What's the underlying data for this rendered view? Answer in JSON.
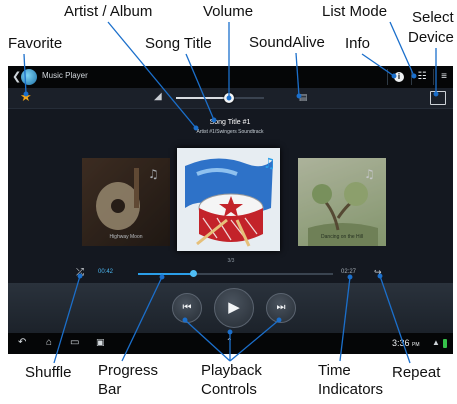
{
  "annotations": {
    "artist_album": "Artist / Album",
    "volume": "Volume",
    "list_mode": "List Mode",
    "select": "Select",
    "device": "Device",
    "favorite": "Favorite",
    "song_title": "Song Title",
    "soundalive": "SoundAlive",
    "info": "Info",
    "shuffle": "Shuffle",
    "progress": "Progress",
    "bar": "Bar",
    "playback": "Playback",
    "controls": "Controls",
    "time": "Time",
    "indicators": "Indicators",
    "repeat": "Repeat"
  },
  "app": {
    "title": "Music Player"
  },
  "now_playing": {
    "title": "Song Title #1",
    "artist_album": "Artist #1/Swingers Soundtrack",
    "counter": "3/3",
    "elapsed": "00:42",
    "duration": "02:27",
    "progress_fraction": 0.28,
    "volume_fraction": 0.6
  },
  "covers": {
    "left_caption": "Highway Moon",
    "right_caption": "Dancing on the Hill"
  },
  "statusbar": {
    "time": "3:36",
    "ampm": "PM"
  },
  "icons": {
    "favorite": "star-icon",
    "volume": "speaker-icon",
    "soundalive": "equalizer-icon",
    "info": "info-icon",
    "list_mode": "list-mode-icon",
    "menu": "menu-icon",
    "select_device": "cast-icon",
    "shuffle": "shuffle-icon",
    "repeat": "repeat-icon",
    "prev": "previous-icon",
    "play": "play-icon",
    "next": "next-icon"
  },
  "colors": {
    "accent": "#2b9ee8",
    "favorite": "#f3a61a",
    "battery": "#36c24a"
  }
}
